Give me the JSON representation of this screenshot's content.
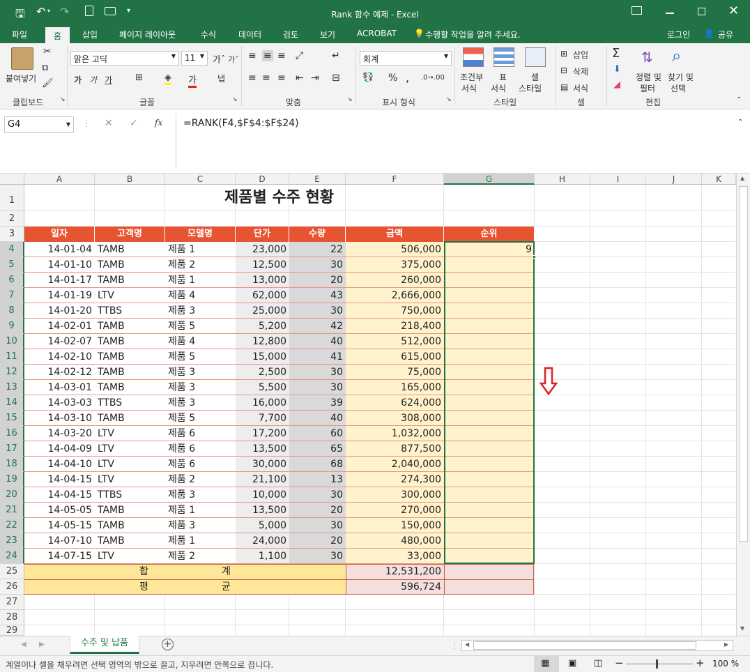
{
  "title_bar": {
    "title": "Rank 함수 예제 - Excel"
  },
  "tabs": [
    "파일",
    "홈",
    "삽입",
    "페이지 레이아웃",
    "수식",
    "데이터",
    "검토",
    "보기",
    "ACROBAT"
  ],
  "tell_me": "수행할 작업을 알려 주세요.",
  "login": "로그인",
  "share": "공유",
  "ribbon": {
    "clipboard": {
      "paste": "붙여넣기",
      "group": "클립보드"
    },
    "font": {
      "name": "맑은 고딕",
      "size": "11",
      "group": "글꼴",
      "bold": "가",
      "italic": "가",
      "underline": "가"
    },
    "align": {
      "group": "맞춤",
      "wrap": "냅"
    },
    "number": {
      "format": "회계",
      "group": "표시 형식",
      "percent": "%",
      "comma": ","
    },
    "styles": {
      "cond": [
        "조건부",
        "서식"
      ],
      "table": [
        "표",
        "서식"
      ],
      "cell": [
        "셀",
        "스타일"
      ],
      "group": "스타일"
    },
    "cells": {
      "insert": "삽입",
      "delete": "삭제",
      "format": "서식",
      "group": "셀"
    },
    "edit": {
      "sort": [
        "정렬 및",
        "필터"
      ],
      "find": [
        "찾기 및",
        "선택"
      ],
      "group": "편집"
    }
  },
  "formula_bar": {
    "name_box": "G4",
    "formula": "=RANK(F4,$F$4:$F$24)"
  },
  "columns": [
    "A",
    "B",
    "C",
    "D",
    "E",
    "F",
    "G",
    "H",
    "I",
    "J",
    "K"
  ],
  "sheet_title": "제품별 수주 현황",
  "headers": [
    "일자",
    "고객명",
    "모델명",
    "단가",
    "수량",
    "금액",
    "순위"
  ],
  "rows": [
    [
      "14-01-04",
      "TAMB",
      "제품 1",
      "23,000",
      "22",
      "506,000",
      "9"
    ],
    [
      "14-01-10",
      "TAMB",
      "제품 2",
      "12,500",
      "30",
      "375,000",
      ""
    ],
    [
      "14-01-17",
      "TAMB",
      "제품 1",
      "13,000",
      "20",
      "260,000",
      ""
    ],
    [
      "14-01-19",
      "LTV",
      "제품 4",
      "62,000",
      "43",
      "2,666,000",
      ""
    ],
    [
      "14-01-20",
      "TTBS",
      "제품 3",
      "25,000",
      "30",
      "750,000",
      ""
    ],
    [
      "14-02-01",
      "TAMB",
      "제품 5",
      "5,200",
      "42",
      "218,400",
      ""
    ],
    [
      "14-02-07",
      "TAMB",
      "제품 4",
      "12,800",
      "40",
      "512,000",
      ""
    ],
    [
      "14-02-10",
      "TAMB",
      "제품 5",
      "15,000",
      "41",
      "615,000",
      ""
    ],
    [
      "14-02-12",
      "TAMB",
      "제품 3",
      "2,500",
      "30",
      "75,000",
      ""
    ],
    [
      "14-03-01",
      "TAMB",
      "제품 3",
      "5,500",
      "30",
      "165,000",
      ""
    ],
    [
      "14-03-03",
      "TTBS",
      "제품 3",
      "16,000",
      "39",
      "624,000",
      ""
    ],
    [
      "14-03-10",
      "TAMB",
      "제품 5",
      "7,700",
      "40",
      "308,000",
      ""
    ],
    [
      "14-03-20",
      "LTV",
      "제품 6",
      "17,200",
      "60",
      "1,032,000",
      ""
    ],
    [
      "14-04-09",
      "LTV",
      "제품 6",
      "13,500",
      "65",
      "877,500",
      ""
    ],
    [
      "14-04-10",
      "LTV",
      "제품 6",
      "30,000",
      "68",
      "2,040,000",
      ""
    ],
    [
      "14-04-15",
      "LTV",
      "제품 2",
      "21,100",
      "13",
      "274,300",
      ""
    ],
    [
      "14-04-15",
      "TTBS",
      "제품 3",
      "10,000",
      "30",
      "300,000",
      ""
    ],
    [
      "14-05-05",
      "TAMB",
      "제품 1",
      "13,500",
      "20",
      "270,000",
      ""
    ],
    [
      "14-05-15",
      "TAMB",
      "제품 3",
      "5,000",
      "30",
      "150,000",
      ""
    ],
    [
      "14-07-10",
      "TAMB",
      "제품 1",
      "24,000",
      "20",
      "480,000",
      ""
    ],
    [
      "14-07-15",
      "LTV",
      "제품 2",
      "1,100",
      "30",
      "33,000",
      ""
    ]
  ],
  "total": {
    "label_left": "합",
    "label_right": "계",
    "value": "12,531,200"
  },
  "average": {
    "label_left": "평",
    "label_right": "균",
    "value": "596,724"
  },
  "row_numbers": [
    "1",
    "2",
    "3",
    "4",
    "5",
    "6",
    "7",
    "8",
    "9",
    "10",
    "11",
    "12",
    "13",
    "14",
    "15",
    "16",
    "17",
    "18",
    "19",
    "20",
    "21",
    "22",
    "23",
    "24",
    "25",
    "26",
    "27",
    "28",
    "29"
  ],
  "sheet_tab": "수주 및 납품",
  "status_text": "계열이나 셀을 채우려면 선택 영역의 밖으로 끌고, 지우려면 안쪽으로 끕니다.",
  "zoom": "100 %",
  "colors": {
    "excel_green": "#217346",
    "header_orange": "#e65431",
    "fill_yellow": "#fff2cc",
    "total_yellow": "#ffe699",
    "gray_fill": "#ededed",
    "pink_fill": "#f4dede",
    "arrow_red": "#e02020"
  }
}
